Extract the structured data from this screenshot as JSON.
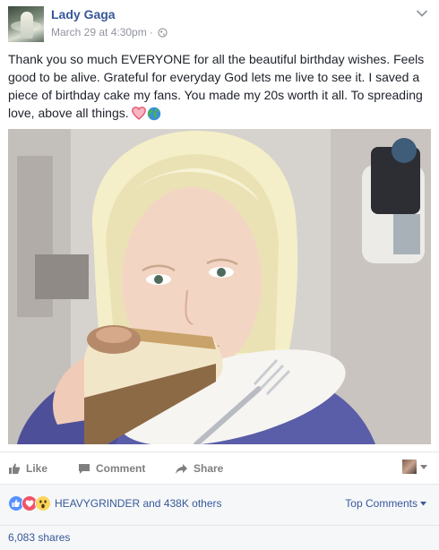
{
  "post": {
    "author": "Lady Gaga",
    "timestamp": "March 29 at 4:30pm",
    "separator": "·",
    "audience_icon": "globe-icon",
    "menu_icon": "chevron-down-icon",
    "caption": "Thank you so much EVERYONE for all the beautiful birthday wishes. Feels good to be alive. Grateful for everyday God lets me live to see it. I saved a piece of birthday cake my fans. You made my 20s worth it all. To spreading love, above all things.",
    "caption_emoji": [
      "heart-icon",
      "earth-globe-icon"
    ]
  },
  "actions": {
    "like": "Like",
    "comment": "Comment",
    "share": "Share"
  },
  "reactions": {
    "icons": [
      "like-reaction-icon",
      "love-reaction-icon",
      "wow-reaction-icon"
    ],
    "summary": "HEAVYGRINDER and 438K others",
    "sort_label": "Top Comments"
  },
  "shares": "6,083 shares",
  "colors": {
    "link": "#365899",
    "meta": "#90949c",
    "text": "#1d2129",
    "action": "#7f7f7f",
    "bar_bg": "#f6f7f9",
    "like_blue": "#5890ff",
    "love_red": "#f25268",
    "wow_yellow": "#fcd55b"
  }
}
